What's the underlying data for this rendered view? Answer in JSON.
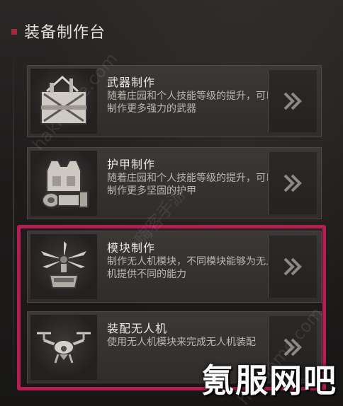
{
  "header": {
    "title": "装备制作台"
  },
  "cards": [
    {
      "title": "武器制作",
      "desc": "随着庄园和个人技能等级的提升，可以制作更多强力的武器",
      "icon": "weapon-crate-icon",
      "arrow_icon": "double-chevron-right-icon"
    },
    {
      "title": "护甲制作",
      "desc": "随着庄园和个人技能等级的提升，可以制作更多坚固的护甲",
      "icon": "armor-vest-icon",
      "arrow_icon": "double-chevron-right-icon"
    },
    {
      "title": "模块制作",
      "desc": "制作无人机模块，不同模块能够为无人机提供不同的能力",
      "icon": "drone-module-icon",
      "arrow_icon": "double-chevron-right-icon"
    },
    {
      "title": "装配无人机",
      "desc": "使用无人机模块来完成无人机装配",
      "icon": "drone-icon",
      "arrow_icon": "double-chevron-right-icon"
    }
  ],
  "watermarks": {
    "site_a": "hakhome.com",
    "site_b": "嗨客手游",
    "brand": "氪服网吧"
  },
  "colors": {
    "highlight": "#b51d55",
    "header_marker": "#a5283c"
  }
}
